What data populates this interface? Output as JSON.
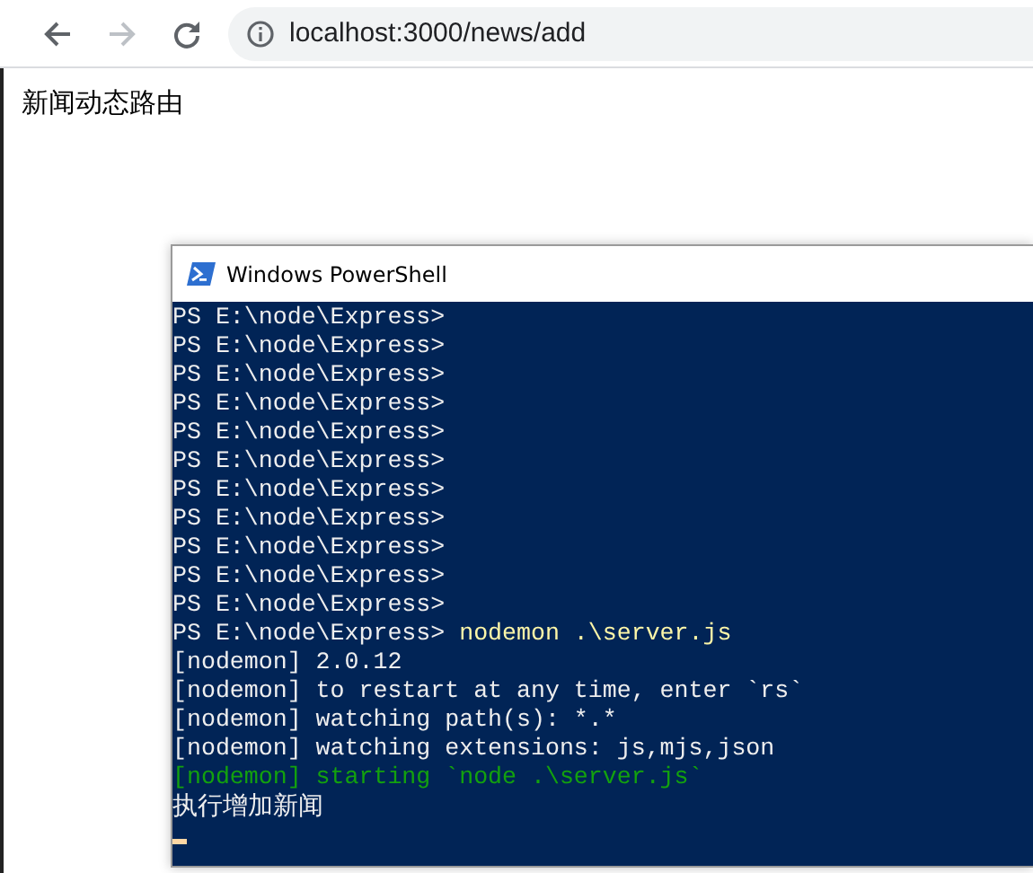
{
  "browser": {
    "address": "localhost:3000/news/add",
    "back_enabled": true,
    "forward_enabled": false
  },
  "page": {
    "text": "新闻动态路由"
  },
  "terminal": {
    "title": "Windows PowerShell",
    "lines": [
      {
        "kind": "prompt",
        "text": "PS E:\\node\\Express>"
      },
      {
        "kind": "prompt",
        "text": "PS E:\\node\\Express>"
      },
      {
        "kind": "prompt",
        "text": "PS E:\\node\\Express>"
      },
      {
        "kind": "prompt",
        "text": "PS E:\\node\\Express>"
      },
      {
        "kind": "prompt",
        "text": "PS E:\\node\\Express>"
      },
      {
        "kind": "prompt",
        "text": "PS E:\\node\\Express>"
      },
      {
        "kind": "prompt",
        "text": "PS E:\\node\\Express>"
      },
      {
        "kind": "prompt",
        "text": "PS E:\\node\\Express>"
      },
      {
        "kind": "prompt",
        "text": "PS E:\\node\\Express>"
      },
      {
        "kind": "prompt",
        "text": "PS E:\\node\\Express>"
      },
      {
        "kind": "prompt",
        "text": "PS E:\\node\\Express>"
      },
      {
        "kind": "command",
        "prompt": "PS E:\\node\\Express>",
        "command": "nodemon .\\server.js"
      },
      {
        "kind": "output",
        "text": "[nodemon] 2.0.12"
      },
      {
        "kind": "output",
        "text": "[nodemon] to restart at any time, enter `rs`"
      },
      {
        "kind": "output",
        "text": "[nodemon] watching path(s): *.*"
      },
      {
        "kind": "output",
        "text": "[nodemon] watching extensions: js,mjs,json"
      },
      {
        "kind": "success",
        "text": "[nodemon] starting `node .\\server.js`"
      },
      {
        "kind": "output",
        "text": "执行增加新闻"
      }
    ],
    "cursor": true
  }
}
